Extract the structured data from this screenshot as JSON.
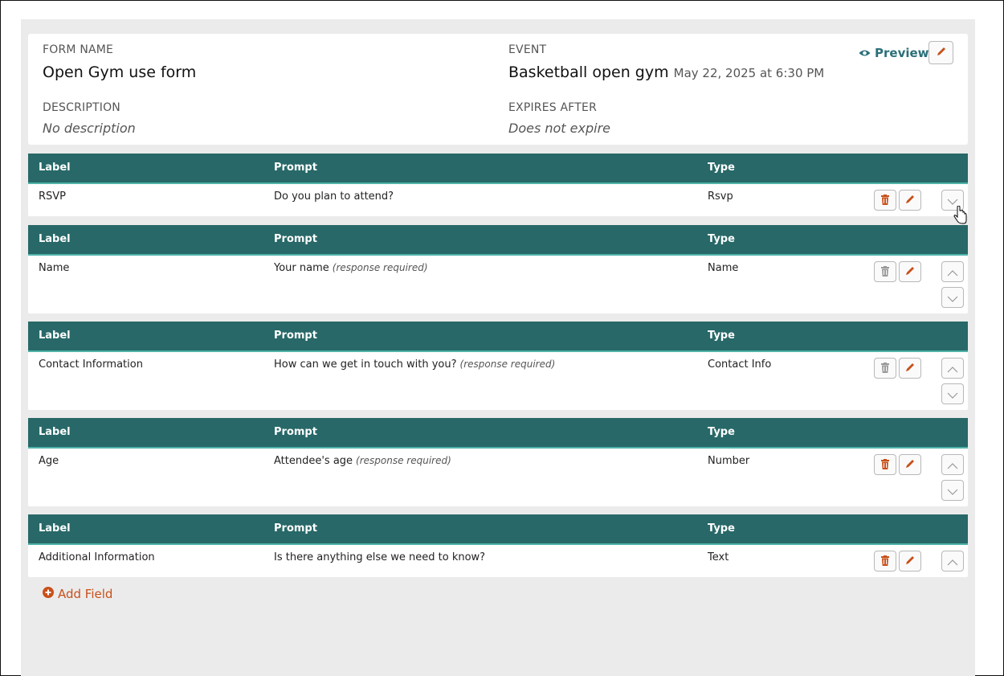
{
  "form": {
    "name_label": "FORM NAME",
    "name": "Open Gym use form",
    "description_label": "DESCRIPTION",
    "description": "No description",
    "event_label": "EVENT",
    "event": "Basketball open gym",
    "event_date": "May 22, 2025 at 6:30 PM",
    "expires_label": "EXPIRES AFTER",
    "expires": "Does not expire",
    "preview_label": "Preview"
  },
  "columns": {
    "label": "Label",
    "prompt": "Prompt",
    "type": "Type"
  },
  "fields": [
    {
      "label": "RSVP",
      "prompt": "Do you plan to attend?",
      "required": "",
      "type": "Rsvp",
      "delete_enabled": true,
      "move_up": false,
      "move_down": true
    },
    {
      "label": "Name",
      "prompt": "Your name",
      "required": "(response required)",
      "type": "Name",
      "delete_enabled": false,
      "move_up": true,
      "move_down": true
    },
    {
      "label": "Contact Information",
      "prompt": "How can we get in touch with you?",
      "required": "(response required)",
      "type": "Contact Info",
      "delete_enabled": false,
      "move_up": true,
      "move_down": true
    },
    {
      "label": "Age",
      "prompt": "Attendee's age",
      "required": "(response required)",
      "type": "Number",
      "delete_enabled": true,
      "move_up": true,
      "move_down": true
    },
    {
      "label": "Additional Information",
      "prompt": "Is there anything else we need to know?",
      "required": "",
      "type": "Text",
      "delete_enabled": true,
      "move_up": true,
      "move_down": false
    }
  ],
  "add_field_label": "Add Field",
  "colors": {
    "header_bg": "#286868",
    "header_underline": "#4fb3aa",
    "accent_orange": "#c8501a",
    "preview_teal": "#2b6f78",
    "panel_bg": "#ebebeb"
  }
}
